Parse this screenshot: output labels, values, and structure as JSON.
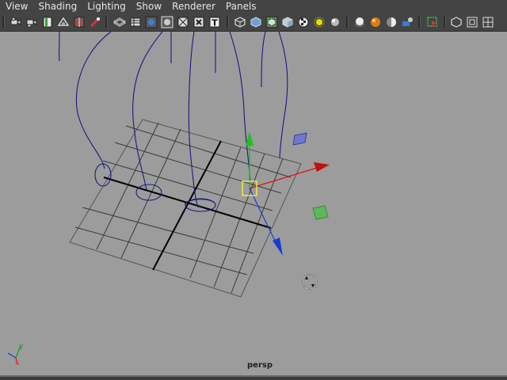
{
  "menu": {
    "items": [
      "View",
      "Shading",
      "Lighting",
      "Show",
      "Renderer",
      "Panels"
    ]
  },
  "toolbar": {
    "icons": [
      "select-camera-icon",
      "camera-attributes-icon",
      "bookmarks-icon",
      "image-plane-icon",
      "grid-icon",
      "film-gate-icon",
      "resolution-gate-icon",
      "wireframe-icon",
      "smooth-shade-icon",
      "wireframe-on-shaded-icon",
      "textured-icon",
      "use-all-lights-icon",
      "shadows-icon",
      "isolate-select-icon",
      "xray-icon",
      "default-material-icon",
      "backface-culling-icon",
      "ambient-occlusion-icon",
      "motion-blur-icon",
      "anti-alias-icon",
      "depth-of-field-icon",
      "highlight-icon",
      "two-panel-icon",
      "four-panel-icon"
    ]
  },
  "viewport": {
    "camera_label": "persp",
    "axis": {
      "x_label": "x",
      "y_label": "y"
    }
  },
  "colors": {
    "viewport_bg": "#9c9c9c",
    "grid_line": "#3a3a3a",
    "grid_axis": "#000000",
    "curve": "#1a1a7e",
    "manip_x": "#e01010",
    "manip_y": "#16c616",
    "manip_z": "#1a3ad6",
    "pivot_box": "#ffff33"
  }
}
